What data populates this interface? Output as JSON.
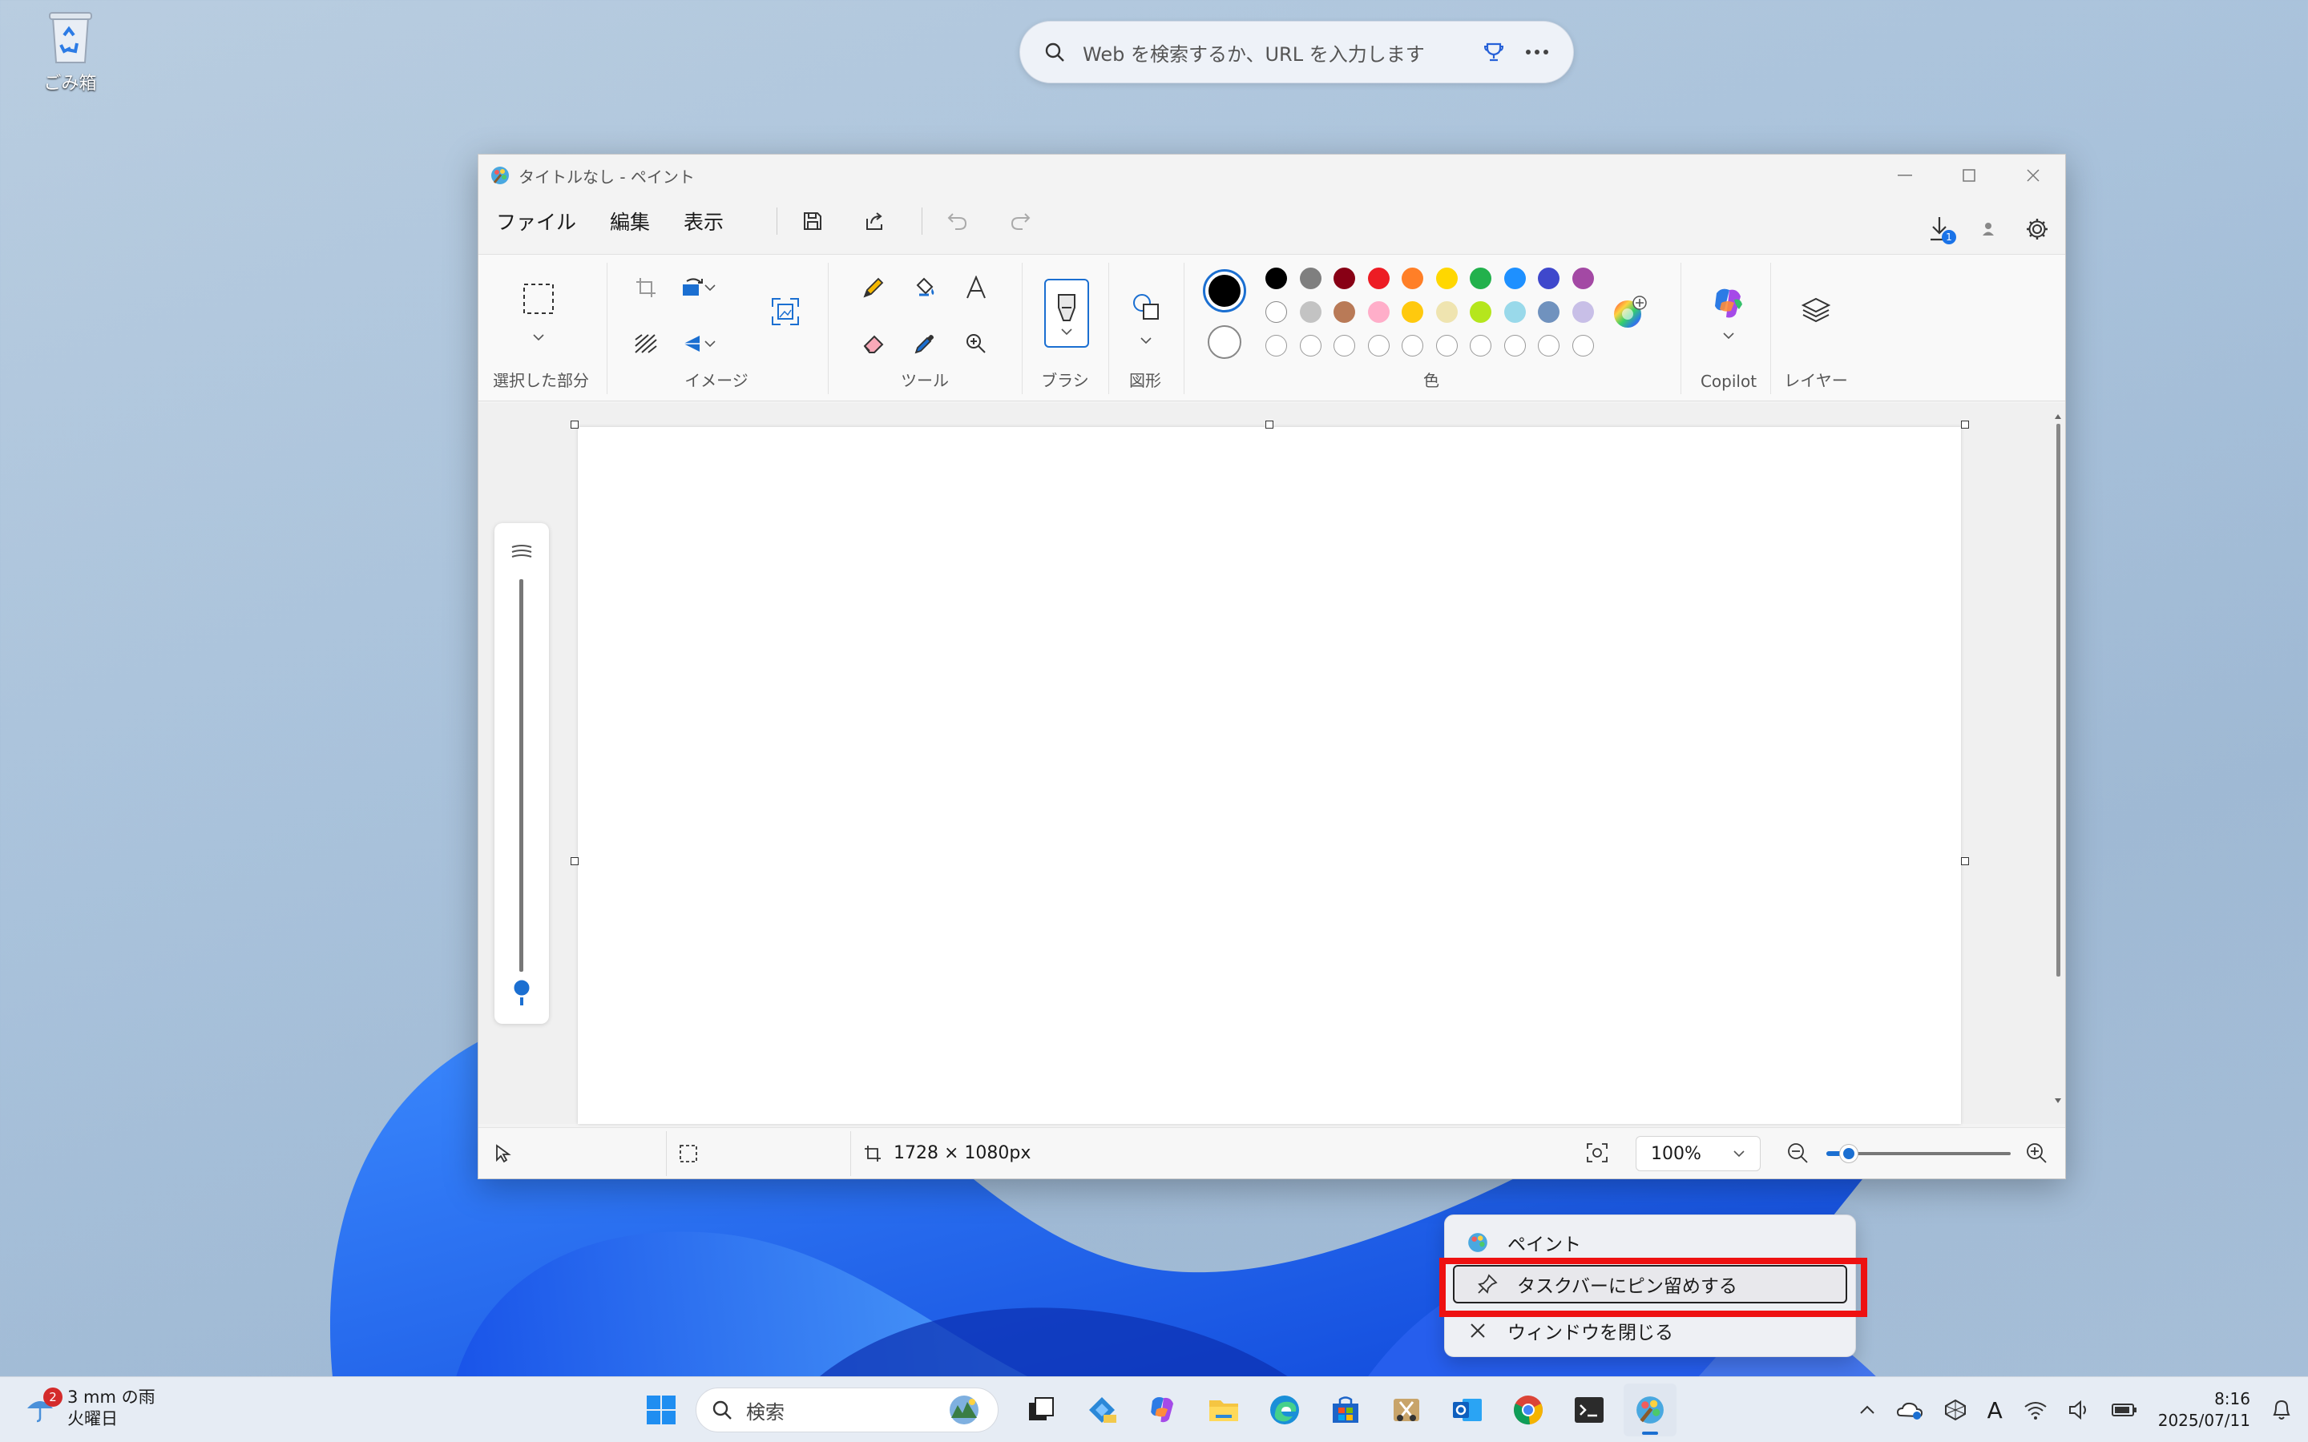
{
  "desktop": {
    "recycle_bin_label": "ごみ箱"
  },
  "browser_search": {
    "placeholder": "Web を検索するか、URL を入力します"
  },
  "paint": {
    "title": "タイトルなし - ペイント",
    "menu": {
      "file": "ファイル",
      "edit": "編集",
      "view": "表示"
    },
    "badge_count": "1",
    "ribbon": {
      "selection": "選択した部分",
      "image": "イメージ",
      "tools": "ツール",
      "brushes": "ブラシ",
      "shapes": "図形",
      "colors": "色",
      "copilot": "Copilot",
      "layers": "レイヤー"
    },
    "palette": {
      "primary": "#000000",
      "secondary": "#ffffff",
      "row1": [
        "#000000",
        "#7f7f7f",
        "#880015",
        "#ed1c24",
        "#ff7f27",
        "#ffd700",
        "#22b14c",
        "#1e90ff",
        "#3f48cc",
        "#a349a4"
      ],
      "row2": [
        "#ffffff",
        "#c3c3c3",
        "#b97a57",
        "#ffaec9",
        "#ffc90e",
        "#efe4b0",
        "#b5e61d",
        "#99d9ea",
        "#7092be",
        "#c8bfe7"
      ]
    },
    "status": {
      "canvas_size": "1728 × 1080px",
      "zoom": "100%",
      "zoom_fraction": 0.12
    }
  },
  "context_menu": {
    "items": [
      "ペイント",
      "タスクバーにピン留めする",
      "ウィンドウを閉じる"
    ]
  },
  "taskbar": {
    "weather_badge": "2",
    "weather_line1": "3 mm の雨",
    "weather_line2": "火曜日",
    "search_placeholder": "検索",
    "time": "8:16",
    "date": "2025/07/11",
    "ime": "A"
  }
}
